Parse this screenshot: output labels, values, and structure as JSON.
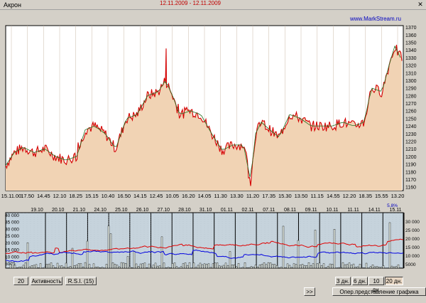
{
  "window": {
    "title": "Акрон",
    "header_red": "12.11.2009 - 12.11.2009",
    "close_icon": "close-icon"
  },
  "colors": {
    "price_fill": "#f1d3b4",
    "price_line": "#d40000",
    "ma_line": "#207020",
    "vol_blue": "#0000e0",
    "vol_red": "#e00000",
    "grid": "#c8b8a8",
    "bg_top": "#ffffff",
    "bg_bottom": "#c6d3dc"
  },
  "top_chart": {
    "watermark": "www.MarkStream.ru",
    "yticks": [
      "1370",
      "1360",
      "1350",
      "1340",
      "1330",
      "1320",
      "1310",
      "1300",
      "1290",
      "1280",
      "1270",
      "1260",
      "1250",
      "1240",
      "1230",
      "1220",
      "1210",
      "1200",
      "1190",
      "1180",
      "1170",
      "1160"
    ],
    "xticks": [
      "15.11.00",
      "17.50",
      "14.45",
      "12.10",
      "18.25",
      "15.15",
      "10.40",
      "16.50",
      "14.15",
      "12.45",
      "10.05",
      "16.20",
      "14.05",
      "11.30",
      "13.30",
      "11.20",
      "17.35",
      "15.30",
      "13.50",
      "11.15",
      "14.55",
      "12.20",
      "18.35",
      "15.55",
      "13.20"
    ]
  },
  "bottom_chart": {
    "percent_label": "5.8%",
    "dates": [
      "19.10",
      "20.10",
      "21.10",
      "24.10",
      "25.10",
      "26.10",
      "27.10",
      "28.10",
      "31.10",
      "01.11",
      "02.11",
      "07.11",
      "08.11",
      "09.11",
      "10.11",
      "11.11",
      "14.11",
      "15.11"
    ],
    "left_ticks": [
      "40 000",
      "35 000",
      "30 000",
      "25 000",
      "20 000",
      "15 000",
      "10 000",
      "5000"
    ],
    "right_ticks": [
      "30 000",
      "25 000",
      "20 000",
      "15 000",
      "10 000",
      "5000"
    ]
  },
  "controls": {
    "period": "20",
    "activity": "Активность",
    "rsi": "R.S.I. (15)",
    "scroll": ">>",
    "range_buttons": [
      "3 дн.",
      "6 дн.",
      "10 дн.",
      "20 дн."
    ],
    "active_range": "20 дн.",
    "oper": "Опер.представление графика"
  }
}
